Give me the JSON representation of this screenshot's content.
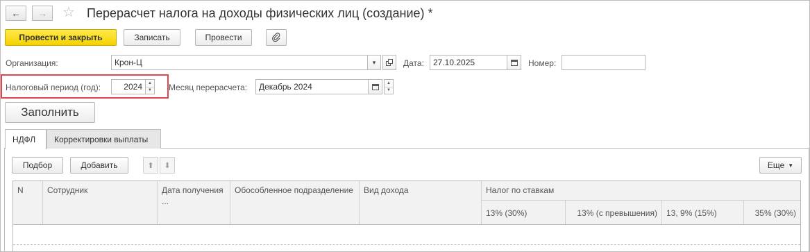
{
  "window": {
    "title": "Перерасчет налога на доходы физических лиц (создание) *",
    "back_icon": "←",
    "forward_icon": "→",
    "favorite_icon": "☆"
  },
  "toolbar": {
    "post_and_close": "Провести и закрыть",
    "save": "Записать",
    "post": "Провести",
    "attach_icon": "paperclip"
  },
  "form": {
    "org_label": "Организация:",
    "org_value": "Крон-Ц",
    "date_label": "Дата:",
    "date_value": "27.10.2025",
    "number_label": "Номер:",
    "number_value": "",
    "tax_period_label": "Налоговый период (год):",
    "tax_period_value": "2024",
    "month_label": "Месяц перерасчета:",
    "month_value": "Декабрь 2024",
    "fill_button": "Заполнить"
  },
  "tabs": [
    {
      "label": "НДФЛ",
      "active": true
    },
    {
      "label": "Корректировки выплаты",
      "active": false
    }
  ],
  "table_toolbar": {
    "select": "Подбор",
    "add": "Добавить",
    "more": "Еще"
  },
  "table": {
    "columns": {
      "n": "N",
      "employee": "Сотрудник",
      "date": "Дата получения ...",
      "division": "Обособленное подразделение",
      "income_type": "Вид дохода",
      "tax_group": "Налог по ставкам",
      "rate1": "13% (30%)",
      "rate2": "13% (с превышения)",
      "rate3": "13, 9% (15%)",
      "rate4": "35% (30%)"
    },
    "rows": []
  },
  "colors": {
    "primary_button": "#f5d200",
    "highlight": "#e0454d"
  }
}
